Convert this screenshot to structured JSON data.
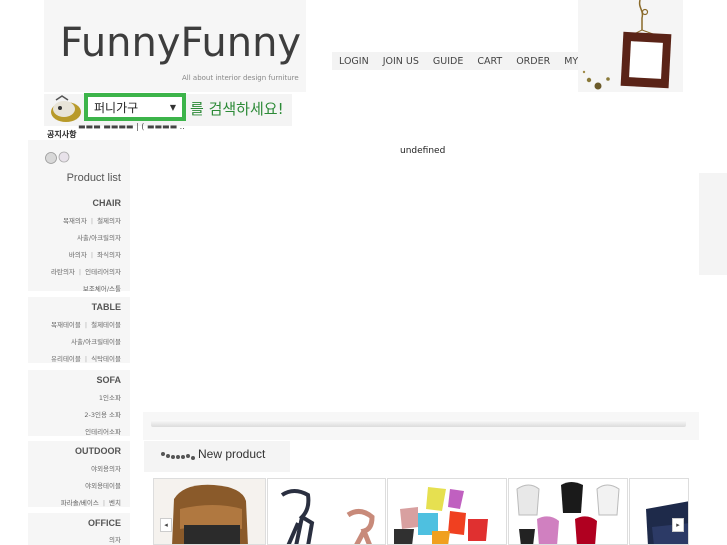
{
  "header": {
    "logo": "FunnyFunny",
    "tagline": "All about interior design furniture"
  },
  "topnav": {
    "items": [
      "LOGIN",
      "JOIN US",
      "GUIDE",
      "CART",
      "ORDER",
      "MY PAGE"
    ]
  },
  "search": {
    "selected": "퍼니가구",
    "hint": "를 검색하세요!"
  },
  "notice": {
    "label": "공지사항",
    "text": "▬▬▬ ▬▬▬▬ | ( ▬▬▬▬ .."
  },
  "main": {
    "status_text": "undefined"
  },
  "sidebar": {
    "title": "Product list",
    "categories": [
      {
        "name": "CHAIR",
        "rows": [
          [
            "목재의자",
            "철제의자"
          ],
          [
            "사출/아크릴의자"
          ],
          [
            "바의자",
            "좌식의자"
          ],
          [
            "라탄의자",
            "인테리어의자"
          ],
          [
            "보조체어/스툴"
          ]
        ]
      },
      {
        "name": "TABLE",
        "rows": [
          [
            "목재테이블",
            "철제테이블"
          ],
          [
            "사출/아크릴테이블"
          ],
          [
            "유리테이블",
            "식탁테이블"
          ]
        ]
      },
      {
        "name": "SOFA",
        "rows": [
          [
            "1인소파"
          ],
          [
            "2-3인용 소파"
          ],
          [
            "인테리어소파"
          ]
        ]
      },
      {
        "name": "OUTDOOR",
        "rows": [
          [
            "야외용의자"
          ],
          [
            "야외용테이블"
          ],
          [
            "파라솔/베이스",
            "벤치"
          ]
        ]
      },
      {
        "name": "OFFICE",
        "rows": [
          [
            "의자"
          ]
        ]
      }
    ]
  },
  "new_product": {
    "title": "New product",
    "prev": "◂",
    "next": "▸"
  },
  "colors": {
    "accent_green": "#3cb44a",
    "panel_gray": "#f6f6f6"
  }
}
